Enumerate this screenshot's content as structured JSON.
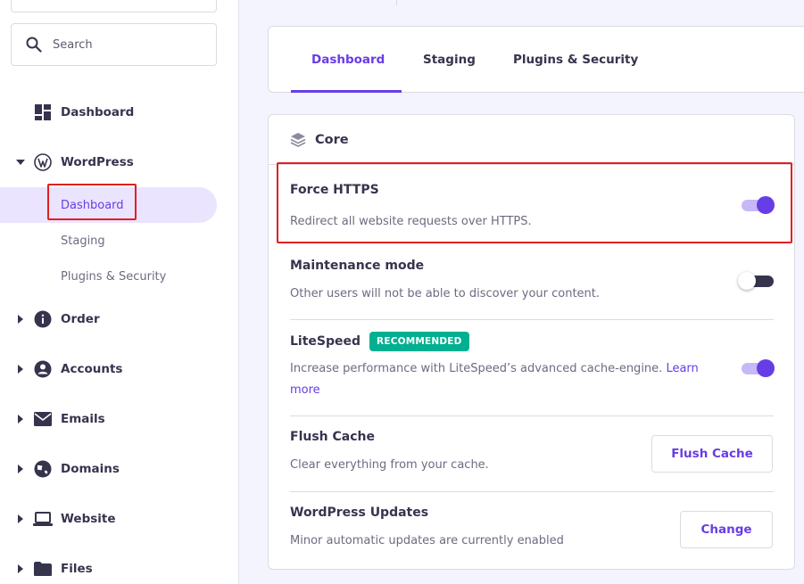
{
  "search": {
    "placeholder": "Search"
  },
  "sidebar": {
    "top_items": [
      {
        "label": "Dashboard",
        "icon": "grid-dashboard-icon"
      },
      {
        "label": "WordPress",
        "icon": "wordpress-icon"
      }
    ],
    "wordpress_sub": [
      {
        "label": "Dashboard",
        "active": true
      },
      {
        "label": "Staging"
      },
      {
        "label": "Plugins & Security"
      }
    ],
    "items": [
      {
        "label": "Order",
        "icon": "info-circle-icon"
      },
      {
        "label": "Accounts",
        "icon": "user-circle-icon"
      },
      {
        "label": "Emails",
        "icon": "envelope-icon"
      },
      {
        "label": "Domains",
        "icon": "globe-icon"
      },
      {
        "label": "Website",
        "icon": "laptop-icon"
      },
      {
        "label": "Files",
        "icon": "folder-icon"
      }
    ]
  },
  "tabs": [
    {
      "label": "Dashboard",
      "active": true
    },
    {
      "label": "Staging"
    },
    {
      "label": "Plugins & Security"
    }
  ],
  "core": {
    "title": "Core",
    "settings": {
      "force_https": {
        "title": "Force HTTPS",
        "desc": "Redirect all website requests over HTTPS.",
        "enabled": true
      },
      "maintenance": {
        "title": "Maintenance mode",
        "desc": "Other users will not be able to discover your content.",
        "enabled": false
      },
      "litespeed": {
        "title": "LiteSpeed",
        "badge": "RECOMMENDED",
        "desc": "Increase performance with LiteSpeed’s advanced cache-engine.",
        "link": "Learn more",
        "enabled": true
      },
      "flush_cache": {
        "title": "Flush Cache",
        "desc": "Clear everything from your cache.",
        "button": "Flush Cache"
      },
      "wp_updates": {
        "title": "WordPress Updates",
        "desc": "Minor automatic updates are currently enabled",
        "button": "Change"
      }
    }
  },
  "colors": {
    "accent": "#673de6",
    "badge": "#00b090",
    "highlight": "#e02020",
    "text": "#36344d",
    "muted": "#6d6b80"
  }
}
